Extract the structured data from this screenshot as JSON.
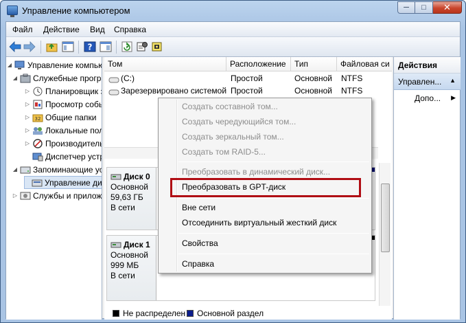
{
  "window": {
    "title": "Управление компьютером",
    "minimize_glyph": "─",
    "maximize_glyph": "□",
    "close_glyph": "✕"
  },
  "menu": [
    "Файл",
    "Действие",
    "Вид",
    "Справка"
  ],
  "toolbar": {
    "icons": [
      "back-arrow-icon",
      "forward-arrow-icon",
      "folder-up-icon",
      "console-tree-icon",
      "help-icon",
      "properties-pane-icon",
      "refresh-icon",
      "settings-icon",
      "disk-manage-icon"
    ],
    "colors": {
      "back": "#2e7dd6",
      "forward": "#2e7dd6",
      "help": "#2457b8",
      "refresh": "#2f8d2f"
    }
  },
  "tree": [
    {
      "label": "Управление компьютером",
      "icon": "computer-management-icon",
      "arrow": "◢"
    },
    {
      "label": "Служебные программы",
      "icon": "tools-icon",
      "arrow": "◢"
    },
    {
      "label": "Планировщик заданий",
      "icon": "clock-icon",
      "arrow": "▷"
    },
    {
      "label": "Просмотр событий",
      "icon": "event-viewer-icon",
      "arrow": "▷"
    },
    {
      "label": "Общие папки",
      "icon": "shared-folder-icon",
      "arrow": "▷"
    },
    {
      "label": "Локальные пользователи",
      "icon": "users-icon",
      "arrow": "▷"
    },
    {
      "label": "Производительность",
      "icon": "performance-icon",
      "arrow": "▷"
    },
    {
      "label": "Диспетчер устройств",
      "icon": "device-manager-icon",
      "arrow": ""
    },
    {
      "label": "Запоминающие устройства",
      "icon": "storage-icon",
      "arrow": "◢"
    },
    {
      "label": "Управление дисками",
      "icon": "disk-management-icon",
      "arrow": ""
    },
    {
      "label": "Службы и приложения",
      "icon": "services-icon",
      "arrow": "▷"
    }
  ],
  "volume_table": {
    "columns": [
      "Том",
      "Расположение",
      "Тип",
      "Файловая си"
    ],
    "rows": [
      {
        "name": "(C:)",
        "layout": "Простой",
        "type": "Основной",
        "fs": "NTFS"
      },
      {
        "name": "Зарезервировано системой",
        "layout": "Простой",
        "type": "Основной",
        "fs": "NTFS"
      }
    ]
  },
  "disks": [
    {
      "name": "Диск 0",
      "kind": "Основной",
      "size": "59,63 ГБ",
      "status": "В сети"
    },
    {
      "name": "Диск 1",
      "kind": "Основной",
      "size": "999 МБ",
      "status": "В сети"
    }
  ],
  "legend": [
    {
      "label": "Не распределен",
      "color": "#000000"
    },
    {
      "label": "Основной раздел",
      "color": "#0b1d8c"
    }
  ],
  "actions": {
    "header": "Действия",
    "section": "Управлен...",
    "item": "Допо..."
  },
  "context_menu": {
    "items": [
      {
        "label": "Создать составной том...",
        "disabled": true
      },
      {
        "label": "Создать чередующийся том...",
        "disabled": true
      },
      {
        "label": "Создать зеркальный том...",
        "disabled": true
      },
      {
        "label": "Создать том RAID-5...",
        "disabled": true
      },
      {
        "label": "Преобразовать в динамический диск...",
        "disabled": true
      },
      {
        "label": "Преобразовать в GPT-диск",
        "disabled": false,
        "highlighted": true
      },
      {
        "label": "Вне сети",
        "disabled": false
      },
      {
        "label": "Отсоединить виртуальный жесткий диск",
        "disabled": false
      },
      {
        "label": "Свойства",
        "disabled": false
      },
      {
        "label": "Справка",
        "disabled": false
      }
    ],
    "highlight_color": "#b00d14"
  }
}
